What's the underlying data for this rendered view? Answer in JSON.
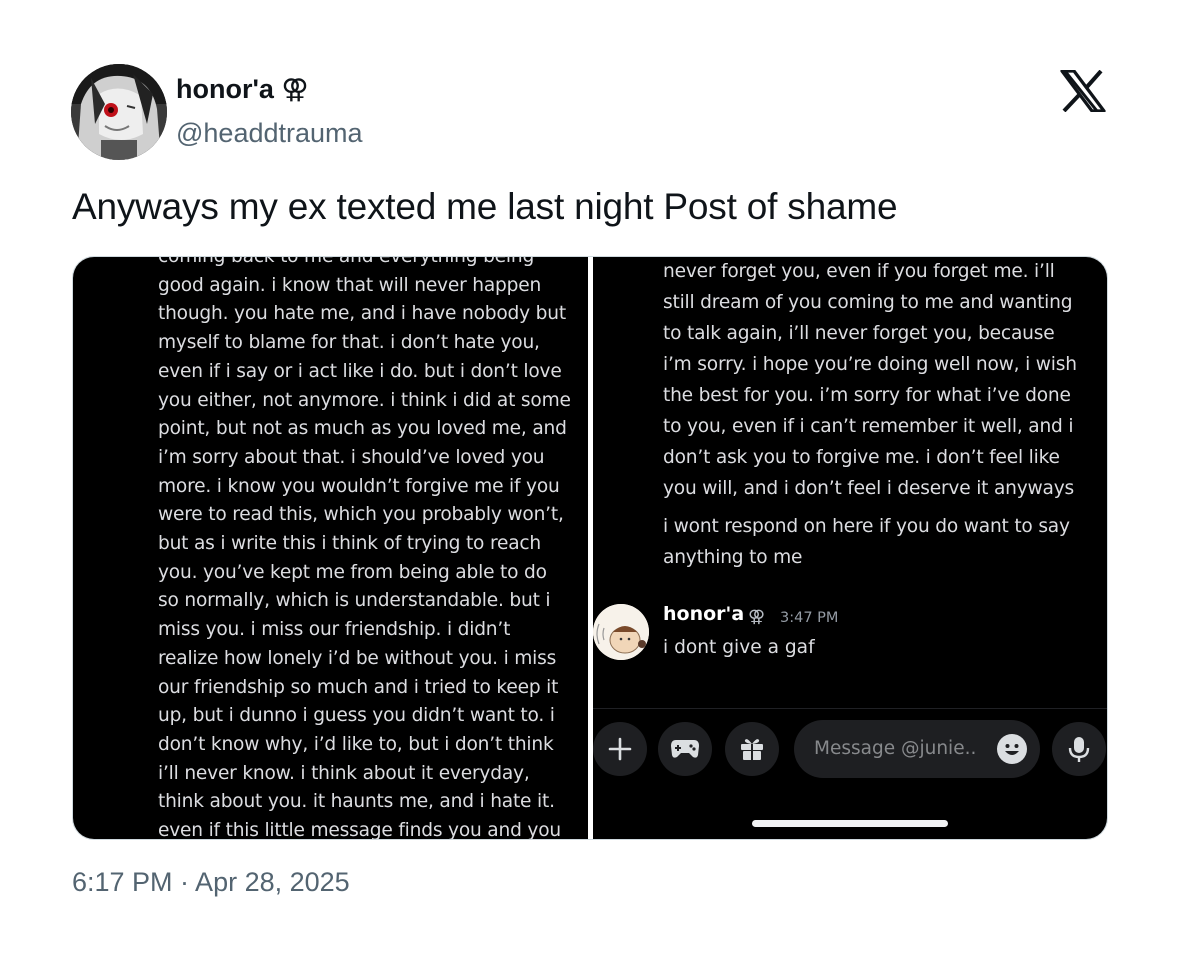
{
  "author": {
    "display_name": "honor'a",
    "badge_symbol": "⚢",
    "handle": "@headdtrauma"
  },
  "tweet": {
    "text": "Anyways my ex texted me last night Post of shame",
    "timestamp": "6:17 PM · Apr 28, 2025"
  },
  "icons": {
    "platform_logo": "x-logo-icon",
    "accent_color": "#0f1419",
    "secondary_color": "#536471"
  },
  "screenshot_left": {
    "message_text": "coming back to me and everything being\ngood again. i know that will never happen\nthough. you hate me, and i have nobody but\nmyself to blame for that. i don’t hate you,\neven if i say or i act like i do. but i don’t love\nyou either, not anymore. i think i did at some\npoint, but not as much as you loved me, and\ni’m sorry about that. i should’ve loved you\nmore. i know you wouldn’t forgive me if you\nwere to read this, which you probably won’t,\nbut as i write this i think of trying to reach\nyou. you’ve kept me from being able to do\nso normally, which is understandable. but i\nmiss you. i miss our friendship. i didn’t\nrealize how lonely i’d be without you. i miss\nour friendship so much and i tried to keep it\nup, but i dunno i guess you didn’t want to. i\ndon’t know why, i’d like to, but i don’t think\ni’ll never know. i think about it everyday,\nthink about you. it haunts me, and i hate it.\neven if this little message finds you and you"
  },
  "screenshot_right": {
    "message_text_1": "never forget you, even if you forget me. i’ll\nstill dream of you coming to me and wanting\nto talk again, i’ll never forget you, because\ni’m sorry. i hope you’re doing well now, i wish\nthe best for you. i’m sorry for what i’ve done\nto you, even if i can’t remember it well, and i\ndon’t ask you to forgive me. i don’t feel like\nyou will, and i don’t feel i deserve it anyways",
    "message_text_2": "i wont respond on here if you do want to say\nanything to me",
    "reply": {
      "author": "honor'a",
      "badge_symbol": "⚢",
      "time": "3:47 PM",
      "text": "i dont give a gaf"
    },
    "composer": {
      "placeholder": "Message @junie..",
      "buttons": [
        "plus-icon",
        "gamepad-icon",
        "gift-icon",
        "emoji-icon",
        "microphone-icon"
      ]
    }
  }
}
